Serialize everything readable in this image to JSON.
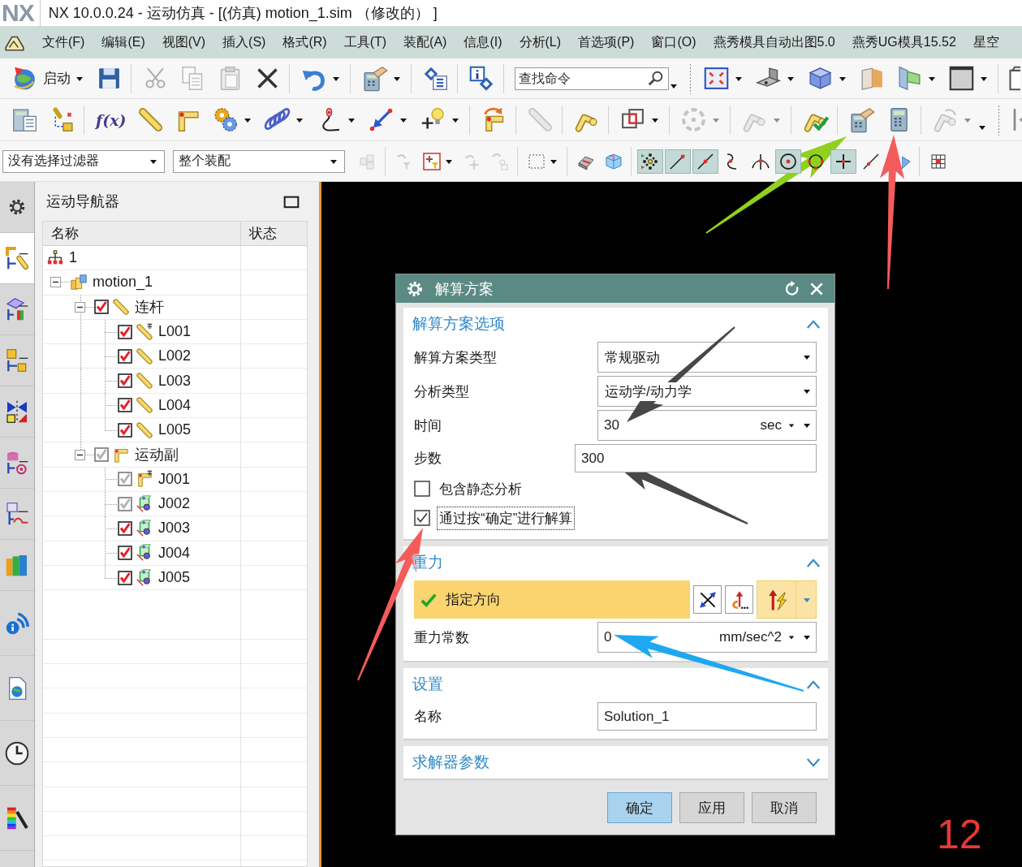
{
  "title_bar": {
    "logo": "NX",
    "title": "NX 10.0.0.24 - 运动仿真 - [(仿真) motion_1.sim （修改的） ]"
  },
  "menu_bar": {
    "items": [
      "文件(F)",
      "编辑(E)",
      "视图(V)",
      "插入(S)",
      "格式(R)",
      "工具(T)",
      "装配(A)",
      "信息(I)",
      "分析(L)",
      "首选项(P)",
      "窗口(O)",
      "燕秀模具自动出图5.0",
      "燕秀UG模具15.52",
      "星空"
    ]
  },
  "toolbar_1": {
    "sections": [
      {
        "groups": [
          {
            "items": [
              {
                "kind": "globe",
                "label": "启动",
                "menu": true,
                "disabled": false
              },
              {
                "kind": "floppy",
                "menu": false,
                "disabled": false
              }
            ]
          },
          {
            "items": [
              {
                "kind": "scissors",
                "menu": false,
                "disabled": true
              },
              {
                "kind": "copy",
                "menu": false,
                "disabled": true
              },
              {
                "kind": "paste",
                "menu": false,
                "disabled": true
              },
              {
                "kind": "cross",
                "menu": false,
                "disabled": false
              }
            ]
          },
          {
            "items": [
              {
                "kind": "undo",
                "menu": true,
                "disabled": false
              }
            ]
          },
          {
            "items": [
              {
                "kind": "calc_hand",
                "menu": true,
                "disabled": false
              }
            ]
          },
          {
            "items": [
              {
                "kind": "diamond_list",
                "menu": false,
                "disabled": false
              }
            ]
          },
          {
            "items": [
              {
                "kind": "info",
                "menu": false,
                "disabled": false
              }
            ]
          },
          {
            "search": {
              "placeholder": "查找命令"
            }
          }
        ]
      },
      {
        "groups": [
          {
            "items": [
              {
                "kind": "fit",
                "menu": true,
                "disabled": false
              },
              {
                "kind": "bracket",
                "menu": true,
                "disabled": false
              },
              {
                "kind": "cube",
                "menu": true,
                "disabled": false
              },
              {
                "kind": "section",
                "menu": false,
                "disabled": false
              },
              {
                "kind": "section_green",
                "menu": true,
                "disabled": false
              },
              {
                "kind": "window",
                "menu": true,
                "disabled": false
              }
            ]
          },
          {
            "items": [
              {
                "kind": "page",
                "disabled": false
              }
            ]
          }
        ]
      }
    ]
  },
  "toolbar_2": {
    "sections": [
      {
        "groups": [
          {
            "items": [
              {
                "kind": "calc_list",
                "menu": false,
                "disabled": false
              },
              {
                "kind": "link_marker",
                "menu": false,
                "disabled": false
              }
            ]
          },
          {
            "items": [
              {
                "kind": "function",
                "label": "f(x)",
                "menu": false,
                "disabled": false
              },
              {
                "kind": "rod",
                "menu": false,
                "disabled": false
              },
              {
                "kind": "joint",
                "menu": false,
                "disabled": false
              },
              {
                "kind": "gears",
                "menu": true,
                "disabled": false
              },
              {
                "kind": "spring",
                "menu": true,
                "disabled": false
              },
              {
                "kind": "curve",
                "menu": true,
                "disabled": false
              },
              {
                "kind": "arrow_points",
                "menu": true,
                "disabled": false
              },
              {
                "kind": "bulb",
                "menu": true,
                "disabled": false
              }
            ]
          },
          {
            "items": [
              {
                "kind": "joint_rotate",
                "menu": false,
                "disabled": false
              }
            ]
          },
          {
            "items": [
              {
                "kind": "rod",
                "menu": false,
                "disabled": true
              }
            ]
          },
          {
            "items": [
              {
                "kind": "arm",
                "menu": false,
                "disabled": false
              }
            ]
          },
          {
            "items": [
              {
                "kind": "overlap",
                "menu": true,
                "disabled": false
              }
            ]
          },
          {
            "items": [
              {
                "kind": "ring",
                "menu": true,
                "disabled": true
              }
            ]
          },
          {
            "items": [
              {
                "kind": "arm",
                "menu": true,
                "disabled": true
              }
            ]
          },
          {
            "items": [
              {
                "kind": "arm_check",
                "menu": false,
                "disabled": false
              }
            ]
          },
          {
            "items": [
              {
                "kind": "calc_hand",
                "menu": false,
                "disabled": false
              },
              {
                "kind": "calculator",
                "menu": false,
                "disabled": false
              }
            ]
          },
          {
            "items": [
              {
                "kind": "arm_rotate",
                "menu": true,
                "disabled": true
              }
            ]
          }
        ]
      },
      {
        "groups": [
          {
            "items": [
              {
                "kind": "collapse",
                "menu": false,
                "disabled": false
              }
            ]
          }
        ]
      }
    ]
  },
  "toolbar_3": {
    "filters": [
      {
        "value": "没有选择过滤器"
      },
      {
        "value": "整个装配"
      }
    ],
    "sections": [
      {
        "groups": [
          {
            "items": [
              {
                "kind": "cubes",
                "menu": false,
                "disabled": true,
                "pressed": false
              }
            ]
          },
          {
            "items": [
              {
                "kind": "filter",
                "menu": false,
                "disabled": true,
                "pressed": false
              },
              {
                "kind": "target_filter",
                "menu": true,
                "disabled": false,
                "pressed": false
              },
              {
                "kind": "move",
                "menu": false,
                "disabled": true,
                "pressed": false
              },
              {
                "kind": "chain",
                "menu": false,
                "disabled": true,
                "pressed": false
              }
            ]
          },
          {
            "items": [
              {
                "kind": "dashed_rect",
                "menu": true,
                "disabled": false,
                "pressed": false
              }
            ]
          },
          {
            "items": [
              {
                "kind": "eraser",
                "menu": false,
                "disabled": false,
                "pressed": false
              },
              {
                "kind": "cube_clear",
                "menu": false,
                "disabled": false,
                "pressed": false
              }
            ]
          },
          {
            "items": [
              {
                "kind": "snap_all",
                "menu": false,
                "disabled": false,
                "pressed": true
              },
              {
                "kind": "line_end",
                "menu": false,
                "disabled": false,
                "pressed": true
              },
              {
                "kind": "line_mid",
                "menu": false,
                "disabled": false,
                "pressed": true
              },
              {
                "kind": "curve_point",
                "menu": false,
                "disabled": false,
                "pressed": false
              },
              {
                "kind": "intersection",
                "menu": false,
                "disabled": false,
                "pressed": false
              },
              {
                "kind": "circle_center",
                "menu": false,
                "disabled": false,
                "pressed": true
              },
              {
                "kind": "circle_quad",
                "menu": false,
                "disabled": false,
                "pressed": false
              },
              {
                "kind": "plus",
                "menu": false,
                "disabled": false,
                "pressed": true
              },
              {
                "kind": "line_point",
                "menu": false,
                "disabled": false,
                "pressed": false
              },
              {
                "kind": "plane",
                "menu": false,
                "disabled": false,
                "pressed": false
              }
            ]
          },
          {
            "items": [
              {
                "kind": "grid",
                "menu": false,
                "disabled": false,
                "pressed": false
              }
            ]
          }
        ]
      }
    ]
  },
  "resource_bar": {
    "tabs": [
      {
        "kind": "gear",
        "selected": false
      },
      {
        "kind": "motion_nav",
        "selected": true
      },
      {
        "kind": "plane_nav",
        "selected": false
      },
      {
        "kind": "parts_nav",
        "selected": false
      },
      {
        "kind": "mirror",
        "selected": false
      },
      {
        "kind": "db_nav",
        "selected": false
      },
      {
        "kind": "history_nav",
        "selected": false
      },
      {
        "kind": "books",
        "selected": false
      },
      {
        "kind": "info_feed",
        "selected": false
      },
      {
        "kind": "web_page",
        "selected": false
      },
      {
        "kind": "clock",
        "selected": false
      },
      {
        "kind": "color_pen",
        "selected": false
      }
    ]
  },
  "navigator": {
    "title": "运动导航器",
    "columns": [
      "名称",
      "状态"
    ],
    "tree": [
      {
        "label": "1",
        "kind": "assembly"
      },
      {
        "label": "motion_1",
        "kind": "sim_file",
        "expanded": true,
        "children": [
          {
            "label": "连杆",
            "kind": "link",
            "expanded": true,
            "checked": true,
            "dimmed": false,
            "children": [
              {
                "label": "L001",
                "kind": "link_fixed",
                "checked": true,
                "dimmed": false
              },
              {
                "label": "L002",
                "kind": "link",
                "checked": true,
                "dimmed": false
              },
              {
                "label": "L003",
                "kind": "link",
                "checked": true,
                "dimmed": false
              },
              {
                "label": "L004",
                "kind": "link",
                "checked": true,
                "dimmed": false
              },
              {
                "label": "L005",
                "kind": "link",
                "checked": true,
                "dimmed": false
              }
            ]
          },
          {
            "label": "运动副",
            "kind": "joint",
            "expanded": true,
            "checked": true,
            "dimmed": true,
            "children": [
              {
                "label": "J001",
                "kind": "joint_fixed",
                "checked": true,
                "dimmed": true
              },
              {
                "label": "J002",
                "kind": "revolute",
                "checked": true,
                "dimmed": true
              },
              {
                "label": "J003",
                "kind": "revolute",
                "checked": true,
                "dimmed": false
              },
              {
                "label": "J004",
                "kind": "revolute",
                "checked": true,
                "dimmed": false
              },
              {
                "label": "J005",
                "kind": "revolute",
                "checked": true,
                "dimmed": false
              }
            ]
          }
        ]
      }
    ]
  },
  "dialog": {
    "title": "解算方案",
    "sections": [
      {
        "title": "解算方案选项",
        "expanded": true,
        "rows": [
          {
            "kind": "dropdown",
            "label": "解算方案类型",
            "value": "常规驱动"
          },
          {
            "kind": "dropdown",
            "label": "分析类型",
            "value": "运动学/动力学"
          },
          {
            "kind": "unit_field",
            "label": "时间",
            "value": "30",
            "unit": "sec"
          },
          {
            "kind": "wide_field",
            "label": "步数",
            "value": "300"
          },
          {
            "kind": "checkbox",
            "label": "包含静态分析",
            "checked": false,
            "focused": false
          },
          {
            "kind": "checkbox",
            "label": "通过按“确定”进行解算",
            "checked": true,
            "focused": true
          }
        ]
      },
      {
        "title": "重力",
        "expanded": true,
        "rows": [
          {
            "kind": "vector",
            "label": "指定方向",
            "done": true,
            "active": true
          },
          {
            "kind": "unit_field",
            "label": "重力常数",
            "value": "0",
            "unit": "mm/sec^2"
          }
        ]
      },
      {
        "title": "设置",
        "expanded": true,
        "rows": [
          {
            "kind": "field",
            "label": "名称",
            "value": "Solution_1"
          }
        ]
      },
      {
        "title": "求解器参数",
        "expanded": false
      }
    ],
    "buttons": [
      {
        "label": "确定",
        "default": true
      },
      {
        "label": "应用",
        "default": false
      },
      {
        "label": "取消",
        "default": false
      }
    ]
  },
  "annotations": {
    "arrows": [
      {
        "color": "#8fd11c"
      },
      {
        "color": "#f45b5b"
      },
      {
        "color": "#474747"
      },
      {
        "color": "#474747"
      },
      {
        "color": "#f45b5b"
      },
      {
        "color": "#1ea8f0"
      }
    ],
    "step_label": "12"
  }
}
